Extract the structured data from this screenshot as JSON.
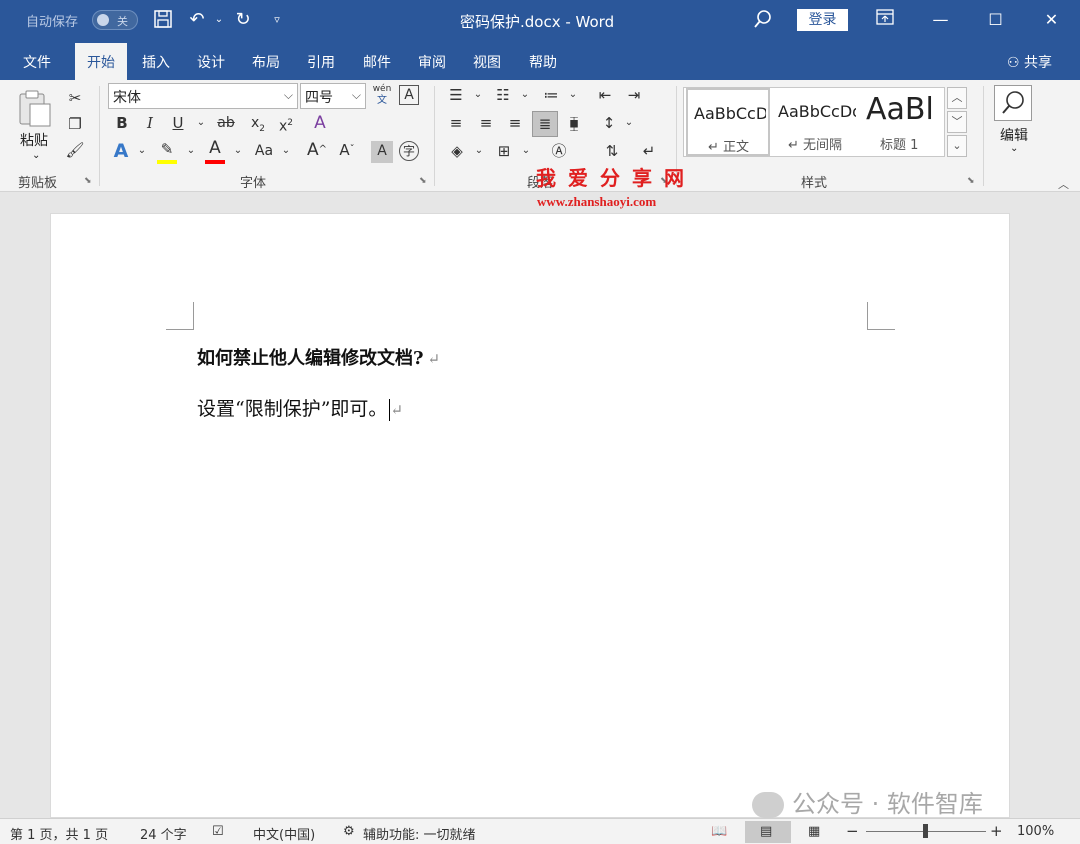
{
  "titlebar": {
    "autosave_label": "自动保存",
    "autosave_state": "关",
    "doc_title": "密码保护.docx  -  Word",
    "login_label": "登录",
    "icons": [
      "save-icon",
      "undo-icon",
      "redo-icon",
      "customize-icon"
    ]
  },
  "tabs": [
    {
      "label": "文件"
    },
    {
      "label": "开始",
      "active": true
    },
    {
      "label": "插入"
    },
    {
      "label": "设计"
    },
    {
      "label": "布局"
    },
    {
      "label": "引用"
    },
    {
      "label": "邮件"
    },
    {
      "label": "审阅"
    },
    {
      "label": "视图"
    },
    {
      "label": "帮助"
    }
  ],
  "share_label": "共享",
  "ribbon": {
    "clipboard": {
      "label": "剪贴板",
      "paste_label": "粘贴"
    },
    "font": {
      "label": "字体",
      "font_name": "宋体",
      "font_size": "四号",
      "phonetic_top": "wén",
      "phonetic_bottom": "文"
    },
    "paragraph": {
      "label": "段落"
    },
    "styles": {
      "label": "样式",
      "items": [
        {
          "sample": "AaBbCcDd",
          "name": "↵ 正文"
        },
        {
          "sample": "AaBbCcDd",
          "name": "↵ 无间隔"
        },
        {
          "sample": "AaBl",
          "name": "标题 1"
        }
      ]
    },
    "editing": {
      "label": "编辑"
    }
  },
  "watermark": {
    "title": "我爱分享网",
    "url": "www.zhanshaoyi.com"
  },
  "document": {
    "heading": "如何禁止他人编辑修改文档?",
    "body": "设置“限制保护”即可。",
    "paragraph_mark": "↵"
  },
  "wechat_watermark": "公众号 · 软件智库",
  "statusbar": {
    "page_info": "第 1 页，共 1 页",
    "word_count": "24 个字",
    "language": "中文(中国)",
    "accessibility": "辅助功能: 一切就绪",
    "zoom": "100%",
    "zoom_minus": "−",
    "zoom_plus": "+"
  },
  "colors": {
    "brand": "#2b579a",
    "highlight": "#ffff00",
    "font_color": "#ff0000",
    "watermark": "#e02020"
  }
}
